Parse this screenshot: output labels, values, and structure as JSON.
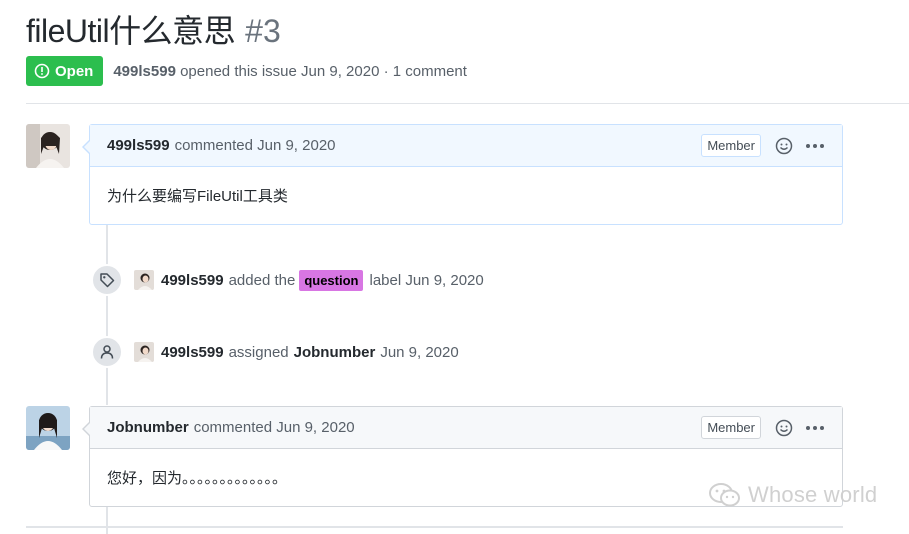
{
  "issue": {
    "title": "fileUtil什么意思",
    "number": "#3",
    "state": "Open",
    "author": "499ls599",
    "opened_text": "opened this issue Jun 9, 2020 · 1 comment"
  },
  "comments": [
    {
      "author": "499ls599",
      "time_text": "commented Jun 9, 2020",
      "role": "Member",
      "body": "为什么要编写FileUtil工具类"
    },
    {
      "author": "Jobnumber",
      "time_text": "commented Jun 9, 2020",
      "role": "Member",
      "body": "您好，因为。。。。。。。。。。。。。"
    }
  ],
  "events": [
    {
      "actor": "499ls599",
      "pre_text": "added the",
      "label": "question",
      "post_text": "label Jun 9, 2020",
      "icon": "tag-icon"
    },
    {
      "actor": "499ls599",
      "pre_text": "assigned",
      "target": "Jobnumber",
      "post_text": "Jun 9, 2020",
      "icon": "person-icon"
    }
  ],
  "watermark": "Whose world",
  "colors": {
    "open_green": "#2cbe4e",
    "label_question": "#d876e3",
    "comment_header_blue": "#f1f8ff"
  }
}
